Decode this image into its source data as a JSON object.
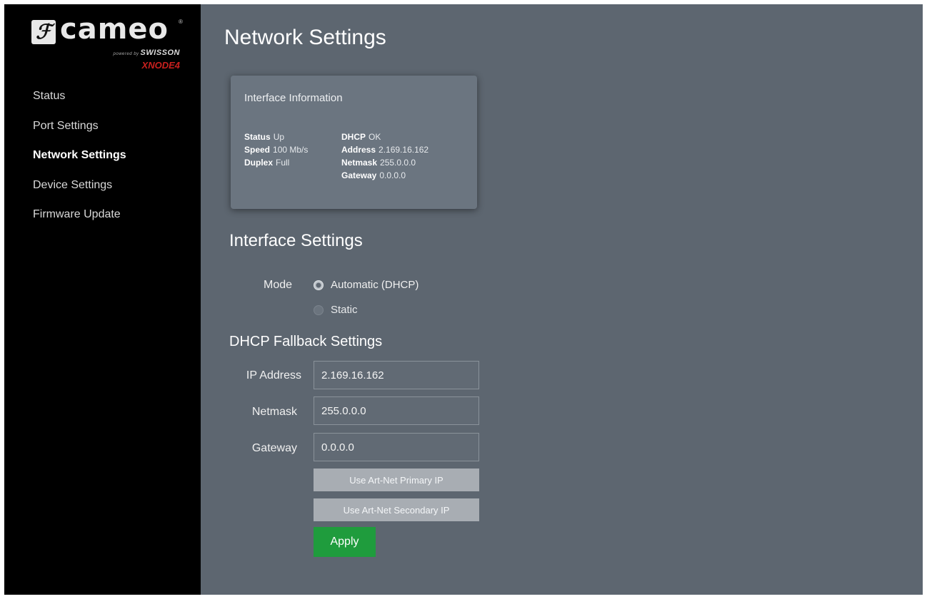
{
  "brand": {
    "logo_mark": "ℱ",
    "name": "cameo",
    "powered_by": "powered by",
    "partner": "SWISSON",
    "model": "XNODE4"
  },
  "nav": {
    "items": [
      {
        "label": "Status",
        "active": false
      },
      {
        "label": "Port Settings",
        "active": false
      },
      {
        "label": "Network Settings",
        "active": true
      },
      {
        "label": "Device Settings",
        "active": false
      },
      {
        "label": "Firmware Update",
        "active": false
      }
    ]
  },
  "page": {
    "title": "Network Settings"
  },
  "interface_info": {
    "title": "Interface Information",
    "status": {
      "label": "Status",
      "value": "Up"
    },
    "speed": {
      "label": "Speed",
      "value": "100 Mb/s"
    },
    "duplex": {
      "label": "Duplex",
      "value": "Full"
    },
    "dhcp": {
      "label": "DHCP",
      "value": "OK"
    },
    "address": {
      "label": "Address",
      "value": "2.169.16.162"
    },
    "netmask": {
      "label": "Netmask",
      "value": "255.0.0.0"
    },
    "gateway": {
      "label": "Gateway",
      "value": "0.0.0.0"
    }
  },
  "interface_settings": {
    "title": "Interface Settings",
    "mode_label": "Mode",
    "options": [
      {
        "label": "Automatic (DHCP)",
        "checked": true
      },
      {
        "label": "Static",
        "checked": false
      }
    ]
  },
  "fallback": {
    "title": "DHCP Fallback Settings",
    "ip_label": "IP Address",
    "ip_value": "2.169.16.162",
    "netmask_label": "Netmask",
    "netmask_value": "255.0.0.0",
    "gateway_label": "Gateway",
    "gateway_value": "0.0.0.0",
    "primary_btn": "Use Art-Net Primary IP",
    "secondary_btn": "Use Art-Net Secondary IP",
    "apply_btn": "Apply"
  },
  "colors": {
    "sidebar_bg": "#000000",
    "main_bg": "#5d6670",
    "card_bg": "#6b7580",
    "apply_green": "#1f9c3d",
    "model_red": "#c8201e"
  }
}
